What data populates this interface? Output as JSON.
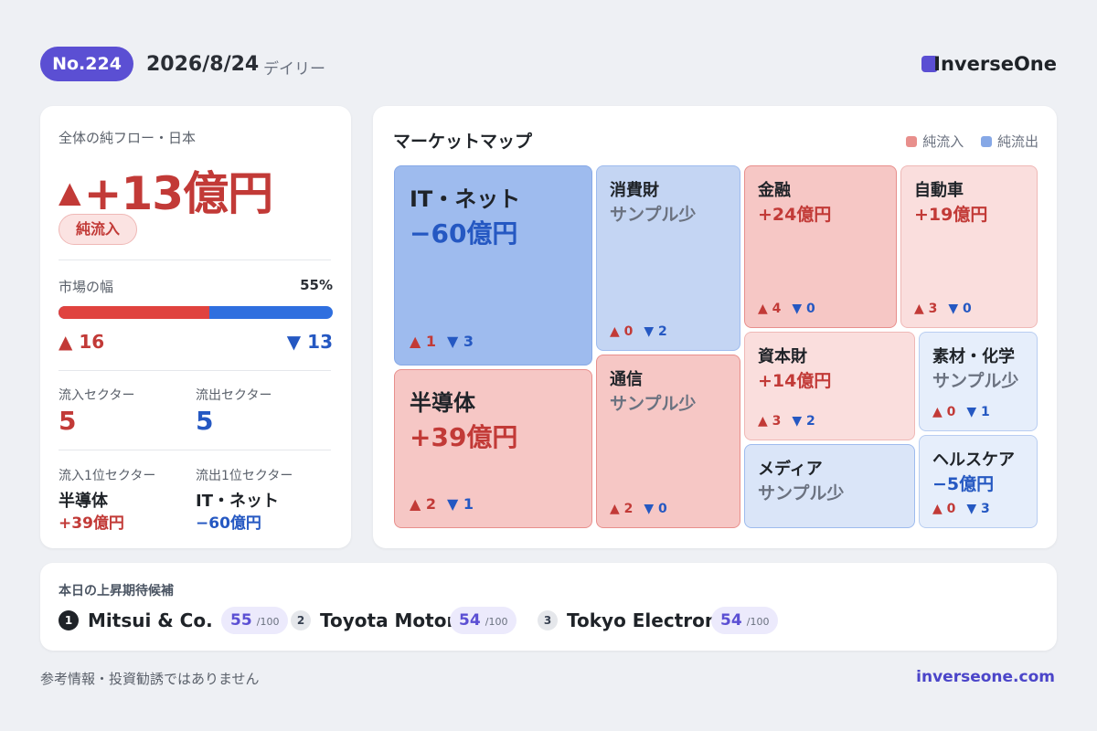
{
  "header": {
    "issue": "No.224",
    "date": "2026/8/24",
    "frequency": "デイリー",
    "brand": "InverseOne",
    "brand_color": "#5b4fd3"
  },
  "summary": {
    "label": "全体の純フロー・日本",
    "arrow": "▲",
    "net_flow": "+13億円",
    "badge": "純流入",
    "breadth_label": "市場の幅",
    "breadth_pct": "55%",
    "breadth_fraction": 0.55,
    "up_arrow": "▲",
    "up_count": "16",
    "down_arrow": "▼",
    "down_count": "13",
    "inflow_sectors_label": "流入セクター",
    "inflow_sectors": "5",
    "outflow_sectors_label": "流出セクター",
    "outflow_sectors": "5",
    "top_inflow_label": "流入1位セクター",
    "top_inflow_name": "半導体",
    "top_inflow_value": "+39億円",
    "top_outflow_label": "流出1位セクター",
    "top_outflow_name": "IT・ネット",
    "top_outflow_value": "−60億円"
  },
  "market_map": {
    "title": "マーケットマップ",
    "legend_in": "純流入",
    "legend_out": "純流出",
    "color_in": "#e88f8c",
    "color_out": "#86a8e6",
    "tiles": [
      {
        "name": "IT・ネット",
        "value": "−60億円",
        "up": "▲ 1",
        "down": "▼ 3"
      },
      {
        "name": "半導体",
        "value": "+39億円",
        "up": "▲ 2",
        "down": "▼ 1"
      },
      {
        "name": "消費財",
        "value": "サンプル少",
        "up": "▲ 0",
        "down": "▼ 2"
      },
      {
        "name": "通信",
        "value": "サンプル少",
        "up": "▲ 2",
        "down": "▼ 0"
      },
      {
        "name": "金融",
        "value": "+24億円",
        "up": "▲ 4",
        "down": "▼ 0"
      },
      {
        "name": "自動車",
        "value": "+19億円",
        "up": "▲ 3",
        "down": "▼ 0"
      },
      {
        "name": "資本財",
        "value": "+14億円",
        "up": "▲ 3",
        "down": "▼ 2"
      },
      {
        "name": "素材・化学",
        "value": "サンプル少",
        "up": "▲ 0",
        "down": "▼ 1"
      },
      {
        "name": "メディア",
        "value": "サンプル少",
        "up": "",
        "down": ""
      },
      {
        "name": "ヘルスケア",
        "value": "−5億円",
        "up": "▲ 0",
        "down": "▼ 3"
      }
    ]
  },
  "picks": {
    "title": "本日の上昇期待候補",
    "items": [
      {
        "rank": "1",
        "name": "Mitsui & Co.",
        "score": "55",
        "denom": "/100"
      },
      {
        "rank": "2",
        "name": "Toyota Motor",
        "score": "54",
        "denom": "/100"
      },
      {
        "rank": "3",
        "name": "Tokyo Electron",
        "score": "54",
        "denom": "/100"
      }
    ]
  },
  "footer": {
    "disclaimer": "参考情報・投資勧誘ではありません",
    "site": "inverseone.com"
  }
}
